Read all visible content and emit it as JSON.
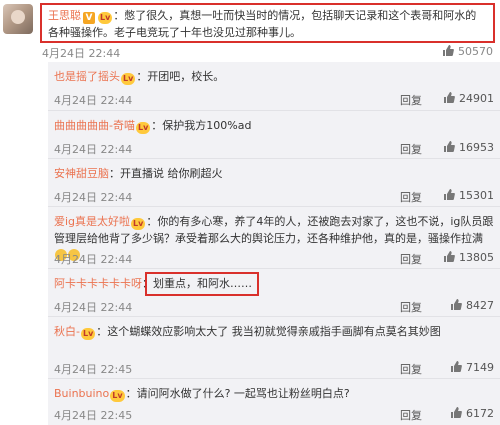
{
  "main": {
    "username": "王思聪",
    "v_badge": "V",
    "level_badge": "Lv",
    "text": "：憋了很久，真想一吐而快当时的情况，包括聊天记录和这个表哥和阿水的各种骚操作。老子电竞玩了十年也没见过那种事儿。",
    "time": "4月24日 22:44",
    "likes": "50570"
  },
  "replies": [
    {
      "username": "也是摇了摇头",
      "badge": "Lv",
      "text": "：开团吧，校长。",
      "time": "4月24日 22:44",
      "reply": "回复",
      "likes": "24901"
    },
    {
      "username": "曲曲曲曲曲-奇喵",
      "badge": "Lv",
      "text": "：保护我方100%ad",
      "time": "4月24日 22:44",
      "reply": "回复",
      "likes": "16953"
    },
    {
      "username": "安神甜豆脑",
      "badge": "",
      "text": "：开直播说 给你刷超火",
      "time": "4月24日 22:44",
      "reply": "回复",
      "likes": "15301"
    },
    {
      "username": "爱ig真是太好啦",
      "badge": "Lv",
      "text": "：你的有多心寒，养了4年的人，还被跑去对家了，这也不说，ig队员跟管理层给他背了多少锅？承受着那么大的舆论压力，还各种维护他，真的是，骚操作拉满",
      "time": "4月24日 22:44",
      "reply": "回复",
      "likes": "13805"
    },
    {
      "username": "阿卡卡卡卡卡卡呀",
      "badge": "",
      "text": "：划重点，和阿水……",
      "time": "4月24日 22:44",
      "reply": "回复",
      "likes": "8427"
    },
    {
      "username": "秋白-",
      "badge": "Lv",
      "text": "：这个蝴蝶效应影响太大了 我当初就觉得亲戚指手画脚有点莫名其妙图",
      "time": "4月24日 22:45",
      "reply": "回复",
      "likes": "7149"
    },
    {
      "username": "Buinbuino",
      "badge": "Lv",
      "text": "：请问阿水做了什么? 一起骂也让粉丝明白点?",
      "time": "4月24日 22:45",
      "reply": "回复",
      "likes": "6172"
    }
  ]
}
